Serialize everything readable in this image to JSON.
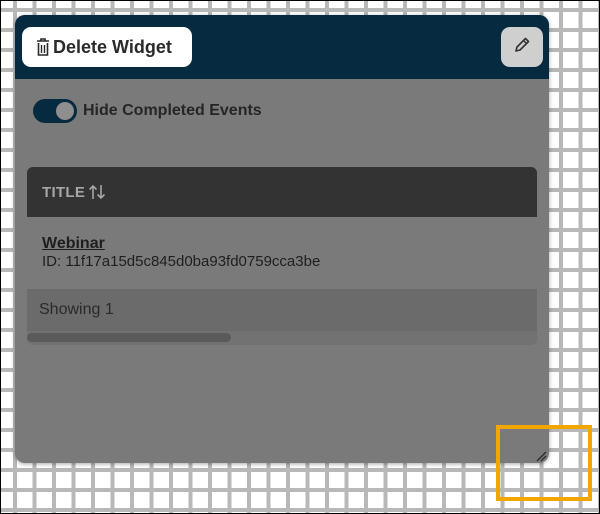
{
  "widget": {
    "delete_label": "Delete Widget",
    "delete_icon": "trash-icon",
    "edit_icon": "pencil-icon",
    "toggle": {
      "label": "Hide Completed Events",
      "state": "on"
    },
    "table": {
      "header": {
        "title": "TITLE",
        "sort_icon": "sort-arrows-icon"
      },
      "rows": [
        {
          "title": "Webinar",
          "id": "ID: 11f17a15d5c845d0ba93fd0759cca3be"
        }
      ],
      "footer": "Showing 1",
      "scrollbar": {
        "thumb_fraction": 0.4
      }
    },
    "resize_icon": "resize-handle-icon"
  },
  "colors": {
    "header_bg": "#062a3f",
    "widget_overlay": "#7a7a7a",
    "highlight": "#f2a600",
    "grid": "#b8b8b8"
  }
}
